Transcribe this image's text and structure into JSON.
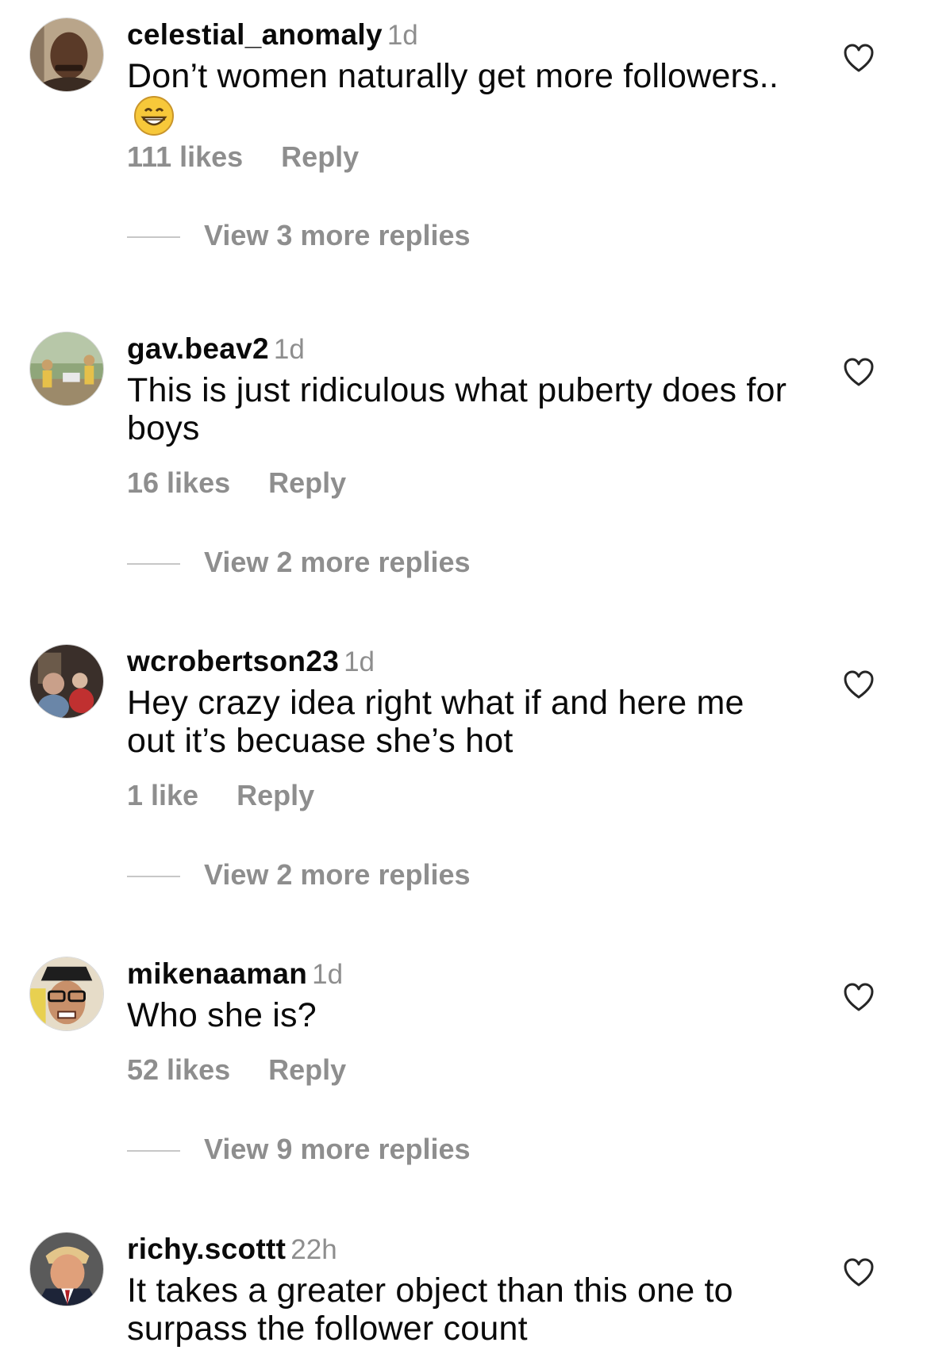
{
  "comments": [
    {
      "username": "celestial_anomaly",
      "time": "1d",
      "text": "Don’t women naturally get more followers..",
      "likes": "111 likes",
      "reply": "Reply",
      "view_replies": "View 3 more replies",
      "emoji": "grinning-face-emoji"
    },
    {
      "username": "gav.beav2",
      "time": "1d",
      "text": "This is just ridiculous what puberty does for boys",
      "likes": "16 likes",
      "reply": "Reply",
      "view_replies": "View 2 more replies"
    },
    {
      "username": "wcrobertson23",
      "time": "1d",
      "text": "Hey crazy idea right what if and here me out it’s becuase she’s hot",
      "likes": "1 like",
      "reply": "Reply",
      "view_replies": "View 2 more replies"
    },
    {
      "username": "mikenaaman",
      "time": "1d",
      "text": "Who she is?",
      "likes": "52 likes",
      "reply": "Reply",
      "view_replies": "View 9 more replies"
    },
    {
      "username": "richy.scottt",
      "time": "22h",
      "text": "It takes a greater object than this one to surpass the follower count"
    }
  ],
  "colors": {
    "text": "#0a0a0a",
    "secondary": "#8e8e8e",
    "divider": "#c7c7c7"
  }
}
